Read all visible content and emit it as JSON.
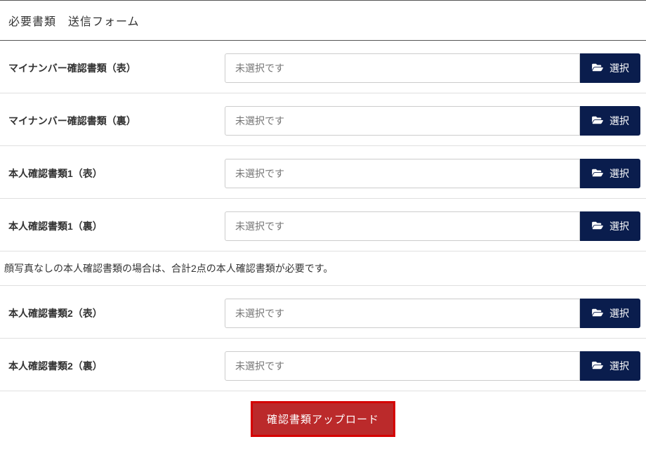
{
  "form": {
    "title": "必要書類　送信フォーム",
    "rows": [
      {
        "label": "マイナンバー確認書類（表）",
        "placeholder": "未選択です",
        "select_label": "選択"
      },
      {
        "label": "マイナンバー確認書類（裏）",
        "placeholder": "未選択です",
        "select_label": "選択"
      },
      {
        "label": "本人確認書類1（表）",
        "placeholder": "未選択です",
        "select_label": "選択"
      },
      {
        "label": "本人確認書類1（裏）",
        "placeholder": "未選択です",
        "select_label": "選択"
      }
    ],
    "note": "顔写真なしの本人確認書類の場合は、合計2点の本人確認書類が必要です。",
    "rows2": [
      {
        "label": "本人確認書類2（表）",
        "placeholder": "未選択です",
        "select_label": "選択"
      },
      {
        "label": "本人確認書類2（裏）",
        "placeholder": "未選択です",
        "select_label": "選択"
      }
    ],
    "submit_label": "確認書類アップロード"
  }
}
